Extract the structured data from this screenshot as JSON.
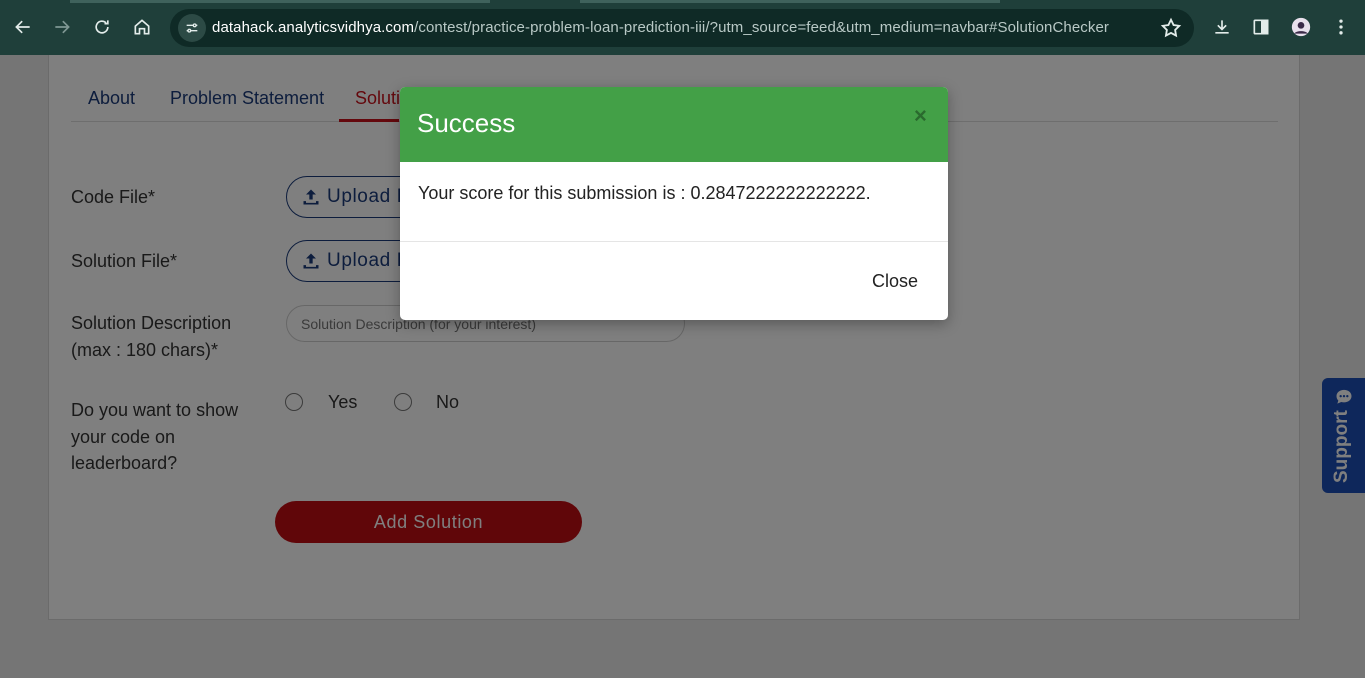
{
  "browser": {
    "url_host": "datahack.analyticsvidhya.com",
    "url_path": "/contest/practice-problem-loan-prediction-iii/?utm_source=feed&utm_medium=navbar#SolutionChecker",
    "icons": [
      "back-icon",
      "forward-icon",
      "reload-icon",
      "home-icon",
      "site-info-icon",
      "bookmark-star-icon",
      "download-icon",
      "side-panel-icon",
      "profile-avatar",
      "more-menu-icon"
    ]
  },
  "tabs": [
    {
      "label": "About"
    },
    {
      "label": "Problem Statement"
    },
    {
      "label": "Soluti"
    }
  ],
  "form": {
    "code_file_label": "Code File*",
    "solution_file_label": "Solution File*",
    "upload_label": "Upload F",
    "description_label_line1": "Solution Description",
    "description_label_line2": "(max : 180 chars)*",
    "description_placeholder": "Solution Description (for your interest)",
    "show_code_line1": "Do you want to show",
    "show_code_line2": "your code on",
    "show_code_line3": "leaderboard?",
    "yes_label": "Yes",
    "no_label": "No",
    "add_solution_label": "Add Solution"
  },
  "support": {
    "label": "Support",
    "icon": "chat-icon"
  },
  "modal": {
    "title": "Success",
    "close_x": "×",
    "message": "Your score for this submission is : 0.2847222222222222.",
    "close_label": "Close"
  },
  "colors": {
    "header_green": "#43a047",
    "accent_red": "#c00d12",
    "link_blue": "#1a3a7a",
    "support_blue": "#1d4fb6"
  }
}
